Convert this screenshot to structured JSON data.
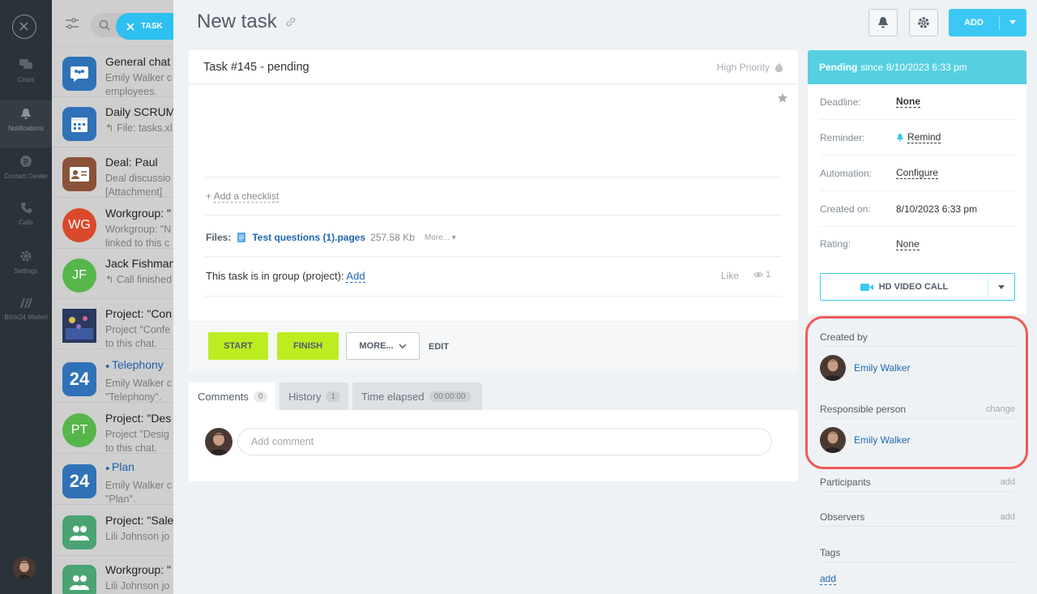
{
  "leftbar": {
    "items": [
      {
        "label": "Chats",
        "icon": "chat-icon"
      },
      {
        "label": "Notifications",
        "icon": "bell-icon"
      },
      {
        "label": "Contact Center",
        "icon": "contact-center-icon"
      },
      {
        "label": "Calls",
        "icon": "phone-icon"
      },
      {
        "label": "Settings",
        "icon": "gear-icon"
      },
      {
        "label": "Bitrix24.Market",
        "icon": "market-icon"
      }
    ]
  },
  "task_pill": {
    "label": "TASK"
  },
  "chats": [
    {
      "title": "General chat",
      "sub1": "Emily Walker c",
      "sub2": "employees.",
      "avatar": "group-chat-icon",
      "color": "#2f72b8"
    },
    {
      "title": "Daily SCRUM",
      "sub1": "↰ File: tasks.xl",
      "sub2": "",
      "avatar": "calendar-icon",
      "color": "#2f72b8"
    },
    {
      "title": "Deal: Paul",
      "sub1": "Deal discussio",
      "sub2": "[Attachment]",
      "avatar": "deal-card-icon",
      "color": "#8a5239"
    },
    {
      "title": "Workgroup: \"",
      "sub1": "Workgroup: \"N",
      "sub2": "linked to this c",
      "avatar": "WG",
      "color": "#d9492a"
    },
    {
      "title": "Jack Fishman",
      "sub1": "↰ Call finished",
      "sub2": "",
      "avatar": "JF",
      "color": "#56b64b"
    },
    {
      "title": "Project: \"Con",
      "sub1": "Project \"Confe",
      "sub2": "to this chat.",
      "avatar": "photo",
      "color": "#2b3960"
    },
    {
      "title": "Telephony",
      "sub1": "Emily Walker c",
      "sub2": "\"Telephony\".",
      "avatar": "24",
      "color": "#2f72b8"
    },
    {
      "title": "Project: \"Des",
      "sub1": "Project \"Desig",
      "sub2": "to this chat.",
      "avatar": "PT",
      "color": "#56b64b"
    },
    {
      "title": "Plan",
      "sub1": "Emily Walker c",
      "sub2": "\"Plan\".",
      "avatar": "24",
      "color": "#2f72b8"
    },
    {
      "title": "Project: \"Sale",
      "sub1": "Lili Johnson jo",
      "sub2": "",
      "avatar": "group-icon",
      "color": "#4aa372"
    },
    {
      "title": "Workgroup: \"",
      "sub1": "Lili Johnson jo",
      "sub2": "",
      "avatar": "group-icon",
      "color": "#4aa372"
    }
  ],
  "page": {
    "title": "New task"
  },
  "header": {
    "add_label": "ADD"
  },
  "task": {
    "heading": "Task #145 - pending",
    "priority": "High Priority",
    "add_checklist": "Add a checklist",
    "files_label": "Files:",
    "file_name": "Test questions (1).pages",
    "file_size": "257.58 Kb",
    "file_more": "More...",
    "group_text": "This task is in group (project):",
    "group_add": "Add",
    "like": "Like",
    "views": "1"
  },
  "actions": {
    "start": "START",
    "finish": "FINISH",
    "more": "MORE...",
    "edit": "EDIT"
  },
  "tabs": [
    {
      "label": "Comments",
      "count": "0"
    },
    {
      "label": "History",
      "count": "1"
    },
    {
      "label": "Time elapsed",
      "count": "00:00:00"
    }
  ],
  "comment": {
    "placeholder": "Add comment"
  },
  "status": {
    "label": "Pending",
    "since": "since 8/10/2023 6:33 pm"
  },
  "details": [
    {
      "key": "Deadline:",
      "value": "None"
    },
    {
      "key": "Reminder:",
      "value": "Remind"
    },
    {
      "key": "Automation:",
      "value": "Configure"
    },
    {
      "key": "Created on:",
      "value": "8/10/2023 6:33 pm"
    },
    {
      "key": "Rating:",
      "value": "None"
    }
  ],
  "video_call": {
    "label": "HD VIDEO CALL"
  },
  "people": {
    "created_by_label": "Created by",
    "created_by": "Emily Walker",
    "responsible_label": "Responsible person",
    "responsible_change": "change",
    "responsible": "Emily Walker",
    "participants_label": "Participants",
    "participants_add": "add",
    "observers_label": "Observers",
    "observers_add": "add",
    "tags_label": "Tags",
    "tags_add": "add"
  },
  "colors": {
    "accent": "#3bc8f5",
    "green": "#bbed21",
    "status": "#56d0e0",
    "highlight": "#ef5a57",
    "link": "#2067b0"
  }
}
